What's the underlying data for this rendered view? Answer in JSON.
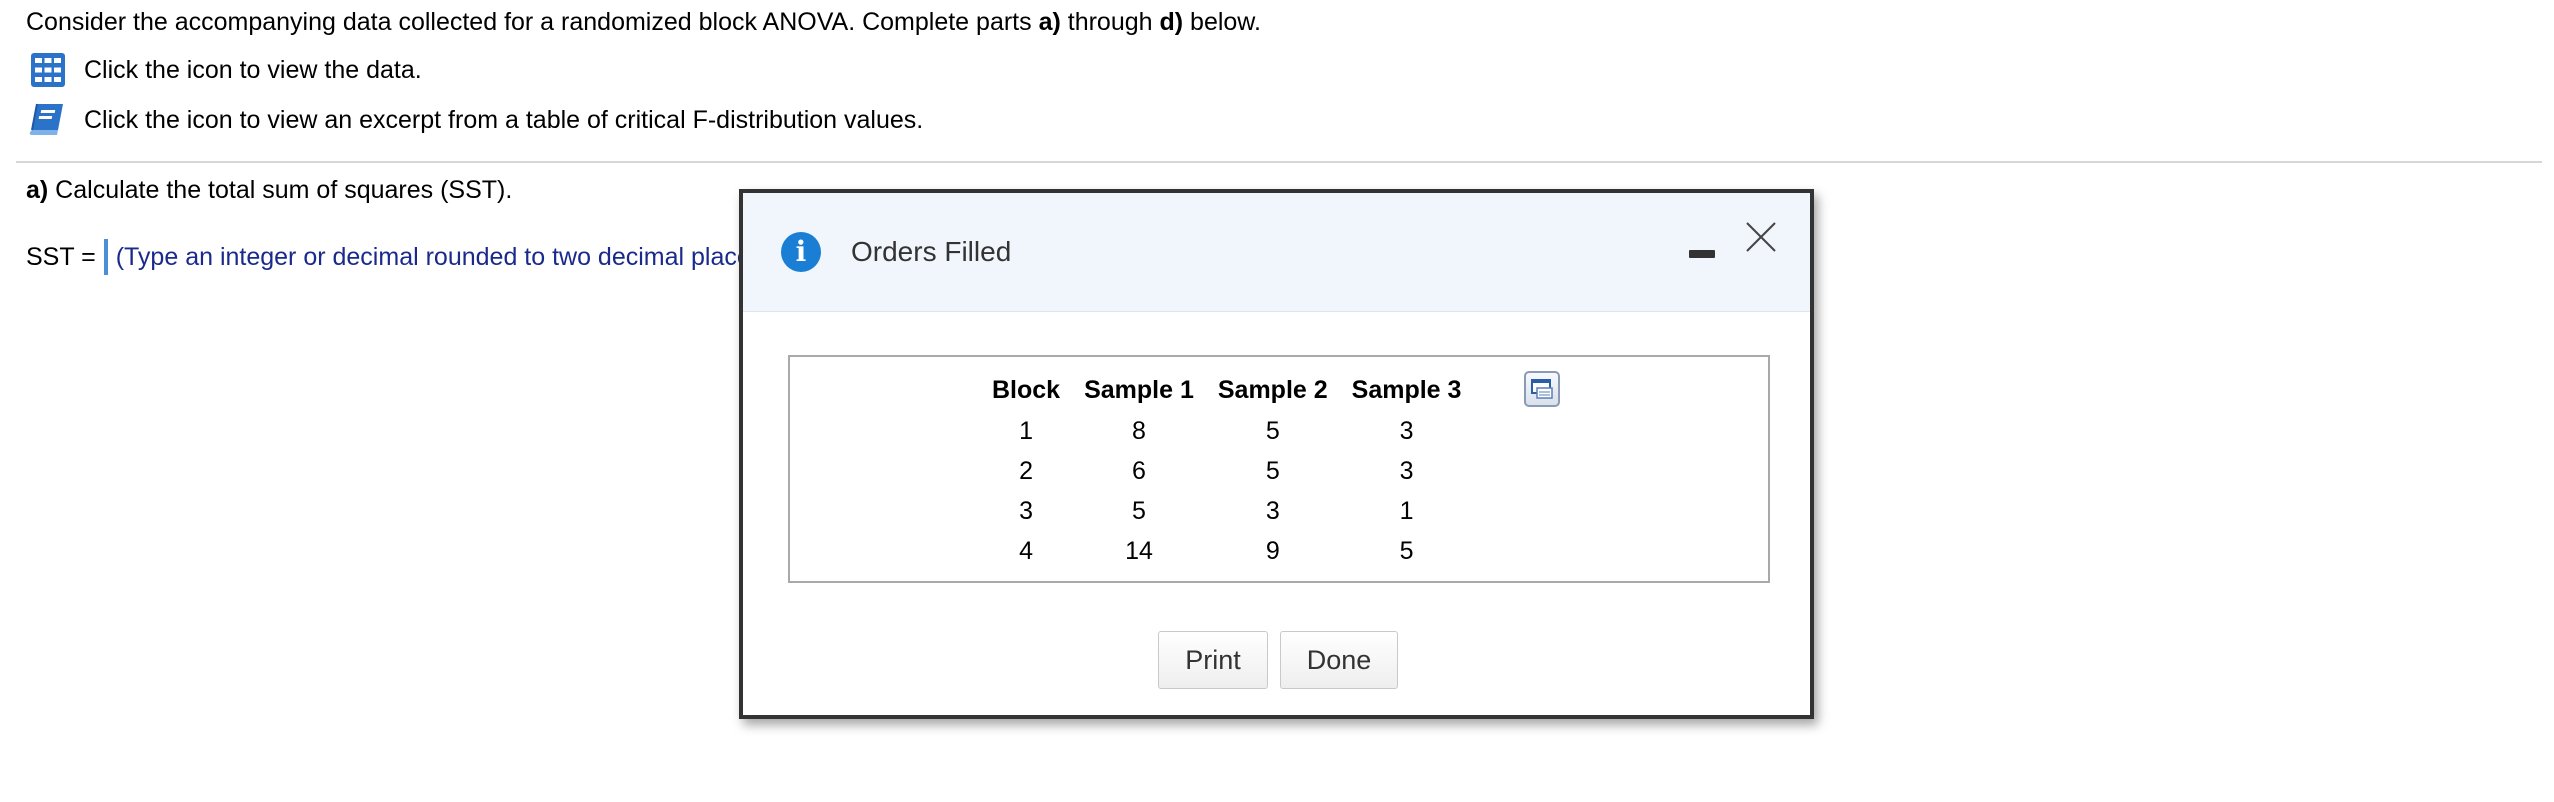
{
  "intro": {
    "part1": "Consider the accompanying data collected for a randomized block ANOVA. Complete parts ",
    "bold_a": "a)",
    "part2": " through ",
    "bold_d": "d)",
    "part3": " below."
  },
  "links": {
    "data_text": "Click the icon to view the data.",
    "table_text": "Click the icon to view an excerpt from a table of critical F-distribution values."
  },
  "part_a": {
    "label": "a)",
    "text": " Calculate the total sum of squares (SST).",
    "answer_label": "SST =",
    "answer_value": "",
    "hint": "(Type an integer or decimal rounded to two decimal places as needed.)"
  },
  "modal": {
    "title": "Orders Filled",
    "columns": [
      "Block",
      "Sample 1",
      "Sample 2",
      "Sample 3"
    ],
    "rows": [
      [
        "1",
        "8",
        "5",
        "3"
      ],
      [
        "2",
        "6",
        "5",
        "3"
      ],
      [
        "3",
        "5",
        "3",
        "1"
      ],
      [
        "4",
        "14",
        "9",
        "5"
      ]
    ],
    "print_label": "Print",
    "done_label": "Done"
  },
  "colors": {
    "accent_blue": "#1a7fd4",
    "hint_text": "#1a2a8c",
    "header_bg": "#f0f6fc"
  }
}
